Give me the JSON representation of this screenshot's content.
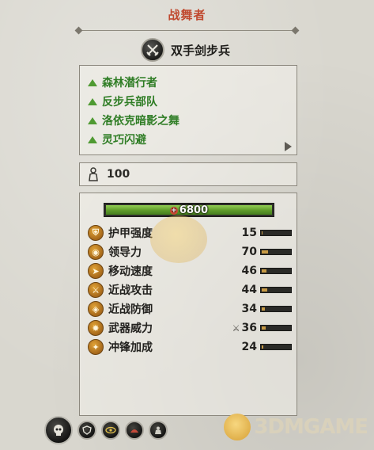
{
  "title": "战舞者",
  "unit_type": {
    "label": "双手剑步兵",
    "icon": "crossed-swords-icon"
  },
  "abilities": [
    {
      "label": "森林潜行者",
      "icon": "green-triangle-icon"
    },
    {
      "label": "反步兵部队",
      "icon": "green-triangle-icon"
    },
    {
      "label": "洛依克暗影之舞",
      "icon": "green-triangle-icon"
    },
    {
      "label": "灵巧闪避",
      "icon": "green-triangle-icon"
    }
  ],
  "men": {
    "icon": "soldier-silhouette-icon",
    "count": "100"
  },
  "health": {
    "value": "6800",
    "fill_fraction": 1.0
  },
  "stats": [
    {
      "label": "护甲强度",
      "value": "15",
      "icon": "armor-icon",
      "bar_fraction": 0.05
    },
    {
      "label": "领导力",
      "value": "70",
      "icon": "leadership-icon",
      "bar_fraction": 0.24
    },
    {
      "label": "移动速度",
      "value": "46",
      "icon": "speed-icon",
      "bar_fraction": 0.18
    },
    {
      "label": "近战攻击",
      "value": "44",
      "icon": "melee-attack-icon",
      "bar_fraction": 0.2
    },
    {
      "label": "近战防御",
      "value": "34",
      "icon": "melee-defense-icon",
      "bar_fraction": 0.14
    },
    {
      "label": "武器威力",
      "value": "36",
      "icon": "weapon-strength-icon",
      "bar_fraction": 0.16,
      "modifier_icon": "weapon-modifier-icon"
    },
    {
      "label": "冲锋加成",
      "value": "24",
      "icon": "charge-bonus-icon",
      "bar_fraction": 0.08
    }
  ],
  "watermark": "3DMGAME",
  "colors": {
    "title": "#c0492f",
    "ability": "#2f7d25",
    "health": "#6aa62e",
    "stat_bar": "#c79a45"
  }
}
